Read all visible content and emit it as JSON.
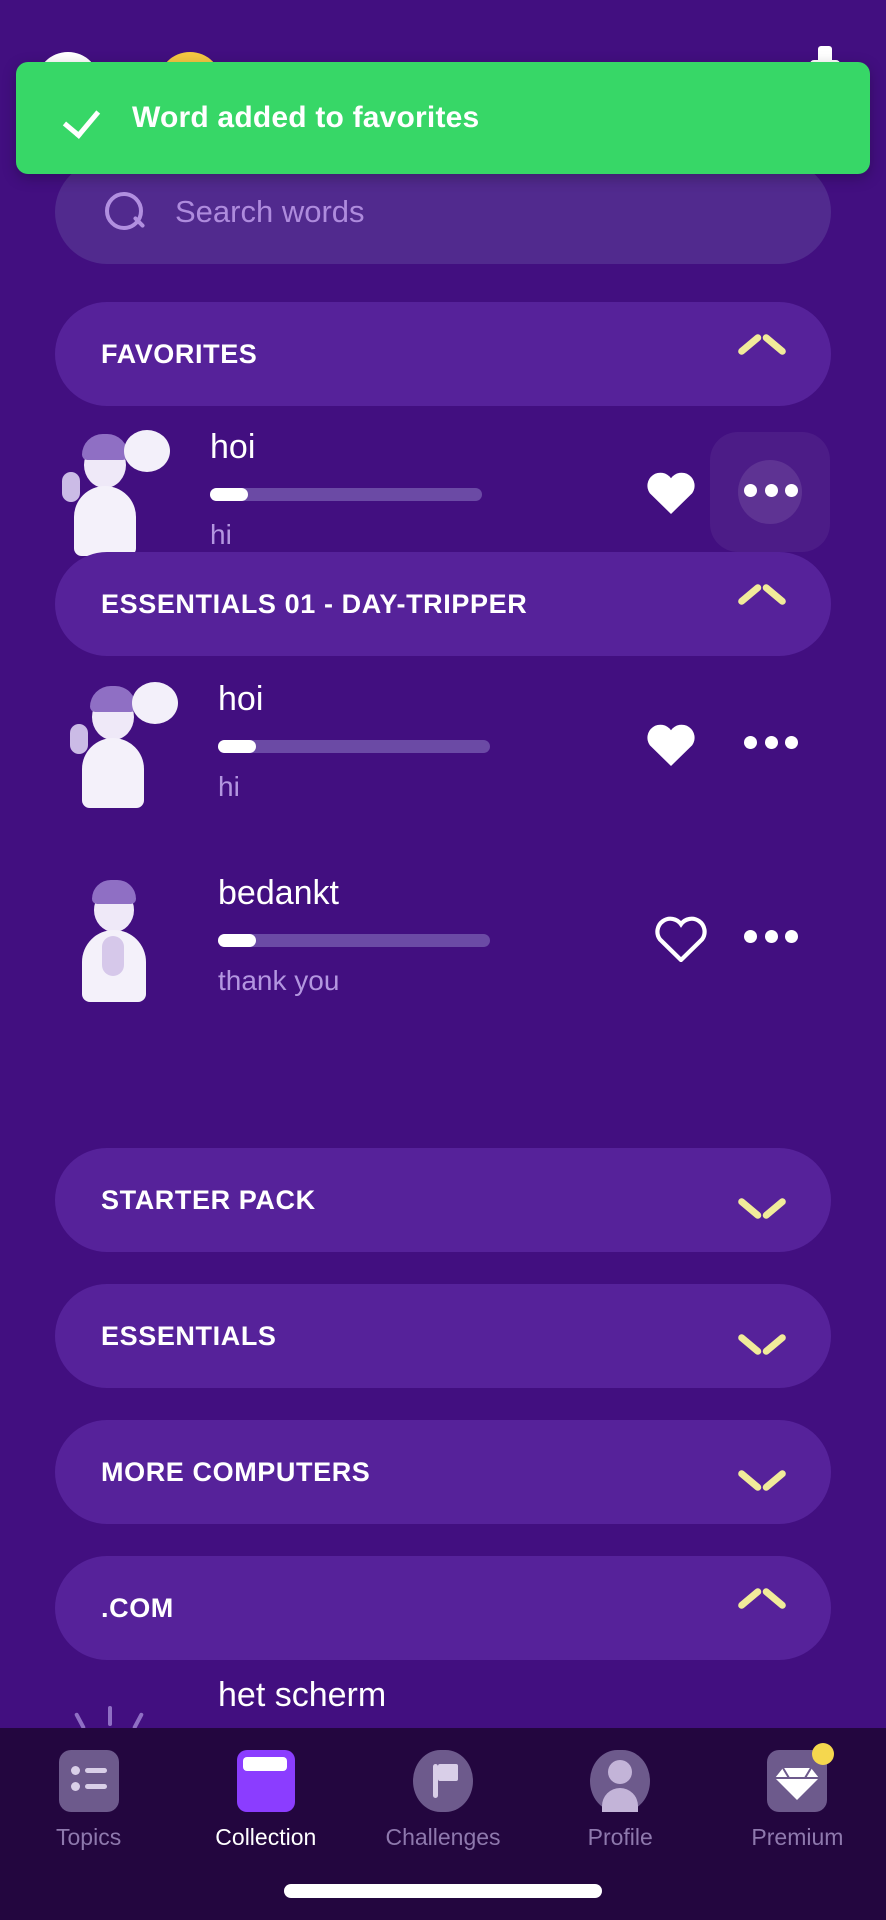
{
  "colors": {
    "background": "#420f80",
    "surface": "#56229a",
    "toast_green": "#37d767",
    "accent_chevron": "#f1eb9a",
    "accent_purple": "#8b3dff",
    "nav_background": "#23063f",
    "muted_text": "#b396e0",
    "badge_yellow": "#f5d74e"
  },
  "toast": {
    "icon": "check-icon",
    "message": "Word added to favorites"
  },
  "search": {
    "icon": "search-icon",
    "placeholder": "Search words",
    "value": ""
  },
  "sections": [
    {
      "title": "FAVORITES",
      "expanded": true,
      "chevron": "chevron-up-icon",
      "words": [
        {
          "term": "hoi",
          "translation": "hi",
          "progress": 14,
          "favorited": true,
          "illustration": "waving-person-with-speech-bubble",
          "menu_icon": "more-options-icon",
          "menu_highlighted": true
        }
      ]
    },
    {
      "title": "ESSENTIALS 01 - DAY-TRIPPER",
      "expanded": true,
      "chevron": "chevron-up-icon",
      "words": [
        {
          "term": "hoi",
          "translation": "hi",
          "progress": 14,
          "favorited": true,
          "illustration": "waving-person-with-speech-bubble",
          "menu_icon": "more-options-icon",
          "menu_highlighted": false
        },
        {
          "term": "bedankt",
          "translation": "thank you",
          "progress": 14,
          "favorited": false,
          "illustration": "person-with-hands-together",
          "menu_icon": "more-options-icon",
          "menu_highlighted": false
        }
      ]
    },
    {
      "title": "STARTER PACK",
      "expanded": false,
      "chevron": "chevron-down-icon",
      "words": []
    },
    {
      "title": "ESSENTIALS",
      "expanded": false,
      "chevron": "chevron-down-icon",
      "words": []
    },
    {
      "title": "MORE COMPUTERS",
      "expanded": false,
      "chevron": "chevron-down-icon",
      "words": []
    },
    {
      "title": ".COM",
      "expanded": true,
      "chevron": "chevron-up-icon",
      "words": [
        {
          "term": "het scherm",
          "translation": "",
          "progress": 0,
          "favorited": false,
          "illustration": "screen-lines",
          "menu_icon": "more-options-icon",
          "menu_highlighted": false
        }
      ]
    }
  ],
  "bottom_nav": {
    "active": "Collection",
    "items": [
      {
        "label": "Topics",
        "icon": "list-icon",
        "active": false,
        "badge": false
      },
      {
        "label": "Collection",
        "icon": "book-icon",
        "active": true,
        "badge": false
      },
      {
        "label": "Challenges",
        "icon": "flag-icon",
        "active": false,
        "badge": false
      },
      {
        "label": "Profile",
        "icon": "person-icon",
        "active": false,
        "badge": false
      },
      {
        "label": "Premium",
        "icon": "diamond-icon",
        "active": false,
        "badge": true
      }
    ]
  }
}
